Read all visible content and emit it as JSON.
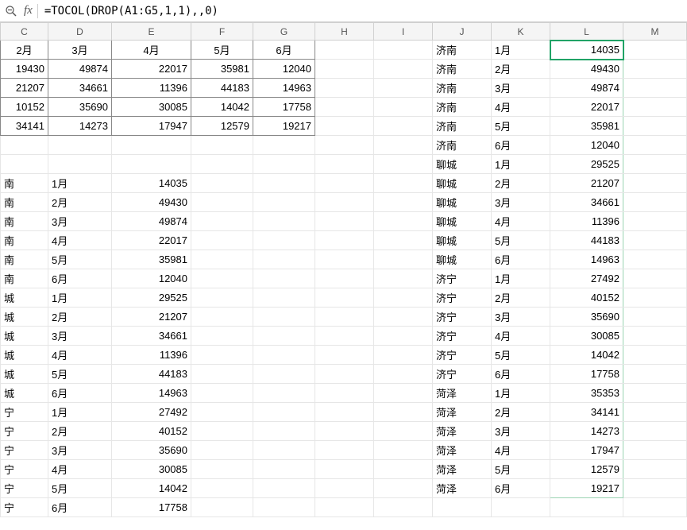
{
  "formula_bar": {
    "fx": "fx",
    "value": "=TOCOL(DROP(A1:G5,1,1),,0)"
  },
  "col_headers": [
    "C",
    "D",
    "E",
    "F",
    "G",
    "H",
    "I",
    "J",
    "K",
    "L",
    "M"
  ],
  "top_table": {
    "header": [
      "2月",
      "3月",
      "4月",
      "5月",
      "6月"
    ],
    "rows": [
      [
        "19430",
        "49874",
        "22017",
        "35981",
        "12040"
      ],
      [
        "21207",
        "34661",
        "11396",
        "44183",
        "14963"
      ],
      [
        "10152",
        "35690",
        "30085",
        "14042",
        "17758"
      ],
      [
        "34141",
        "14273",
        "17947",
        "12579",
        "19217"
      ]
    ]
  },
  "left_list": [
    {
      "city": "南",
      "month": "1月",
      "val": "14035"
    },
    {
      "city": "南",
      "month": "2月",
      "val": "49430"
    },
    {
      "city": "南",
      "month": "3月",
      "val": "49874"
    },
    {
      "city": "南",
      "month": "4月",
      "val": "22017"
    },
    {
      "city": "南",
      "month": "5月",
      "val": "35981"
    },
    {
      "city": "南",
      "month": "6月",
      "val": "12040"
    },
    {
      "city": "城",
      "month": "1月",
      "val": "29525"
    },
    {
      "city": "城",
      "month": "2月",
      "val": "21207"
    },
    {
      "city": "城",
      "month": "3月",
      "val": "34661"
    },
    {
      "city": "城",
      "month": "4月",
      "val": "11396"
    },
    {
      "city": "城",
      "month": "5月",
      "val": "44183"
    },
    {
      "city": "城",
      "month": "6月",
      "val": "14963"
    },
    {
      "city": "宁",
      "month": "1月",
      "val": "27492"
    },
    {
      "city": "宁",
      "month": "2月",
      "val": "40152"
    },
    {
      "city": "宁",
      "month": "3月",
      "val": "35690"
    },
    {
      "city": "宁",
      "month": "4月",
      "val": "30085"
    },
    {
      "city": "宁",
      "month": "5月",
      "val": "14042"
    },
    {
      "city": "宁",
      "month": "6月",
      "val": "17758"
    }
  ],
  "right_list": [
    {
      "city": "济南",
      "month": "1月",
      "val": "14035"
    },
    {
      "city": "济南",
      "month": "2月",
      "val": "49430"
    },
    {
      "city": "济南",
      "month": "3月",
      "val": "49874"
    },
    {
      "city": "济南",
      "month": "4月",
      "val": "22017"
    },
    {
      "city": "济南",
      "month": "5月",
      "val": "35981"
    },
    {
      "city": "济南",
      "month": "6月",
      "val": "12040"
    },
    {
      "city": "聊城",
      "month": "1月",
      "val": "29525"
    },
    {
      "city": "聊城",
      "month": "2月",
      "val": "21207"
    },
    {
      "city": "聊城",
      "month": "3月",
      "val": "34661"
    },
    {
      "city": "聊城",
      "month": "4月",
      "val": "11396"
    },
    {
      "city": "聊城",
      "month": "5月",
      "val": "44183"
    },
    {
      "city": "聊城",
      "month": "6月",
      "val": "14963"
    },
    {
      "city": "济宁",
      "month": "1月",
      "val": "27492"
    },
    {
      "city": "济宁",
      "month": "2月",
      "val": "40152"
    },
    {
      "city": "济宁",
      "month": "3月",
      "val": "35690"
    },
    {
      "city": "济宁",
      "month": "4月",
      "val": "30085"
    },
    {
      "city": "济宁",
      "month": "5月",
      "val": "14042"
    },
    {
      "city": "济宁",
      "month": "6月",
      "val": "17758"
    },
    {
      "city": "菏泽",
      "month": "1月",
      "val": "35353"
    },
    {
      "city": "菏泽",
      "month": "2月",
      "val": "34141"
    },
    {
      "city": "菏泽",
      "month": "3月",
      "val": "14273"
    },
    {
      "city": "菏泽",
      "month": "4月",
      "val": "17947"
    },
    {
      "city": "菏泽",
      "month": "5月",
      "val": "12579"
    },
    {
      "city": "菏泽",
      "month": "6月",
      "val": "19217"
    }
  ]
}
